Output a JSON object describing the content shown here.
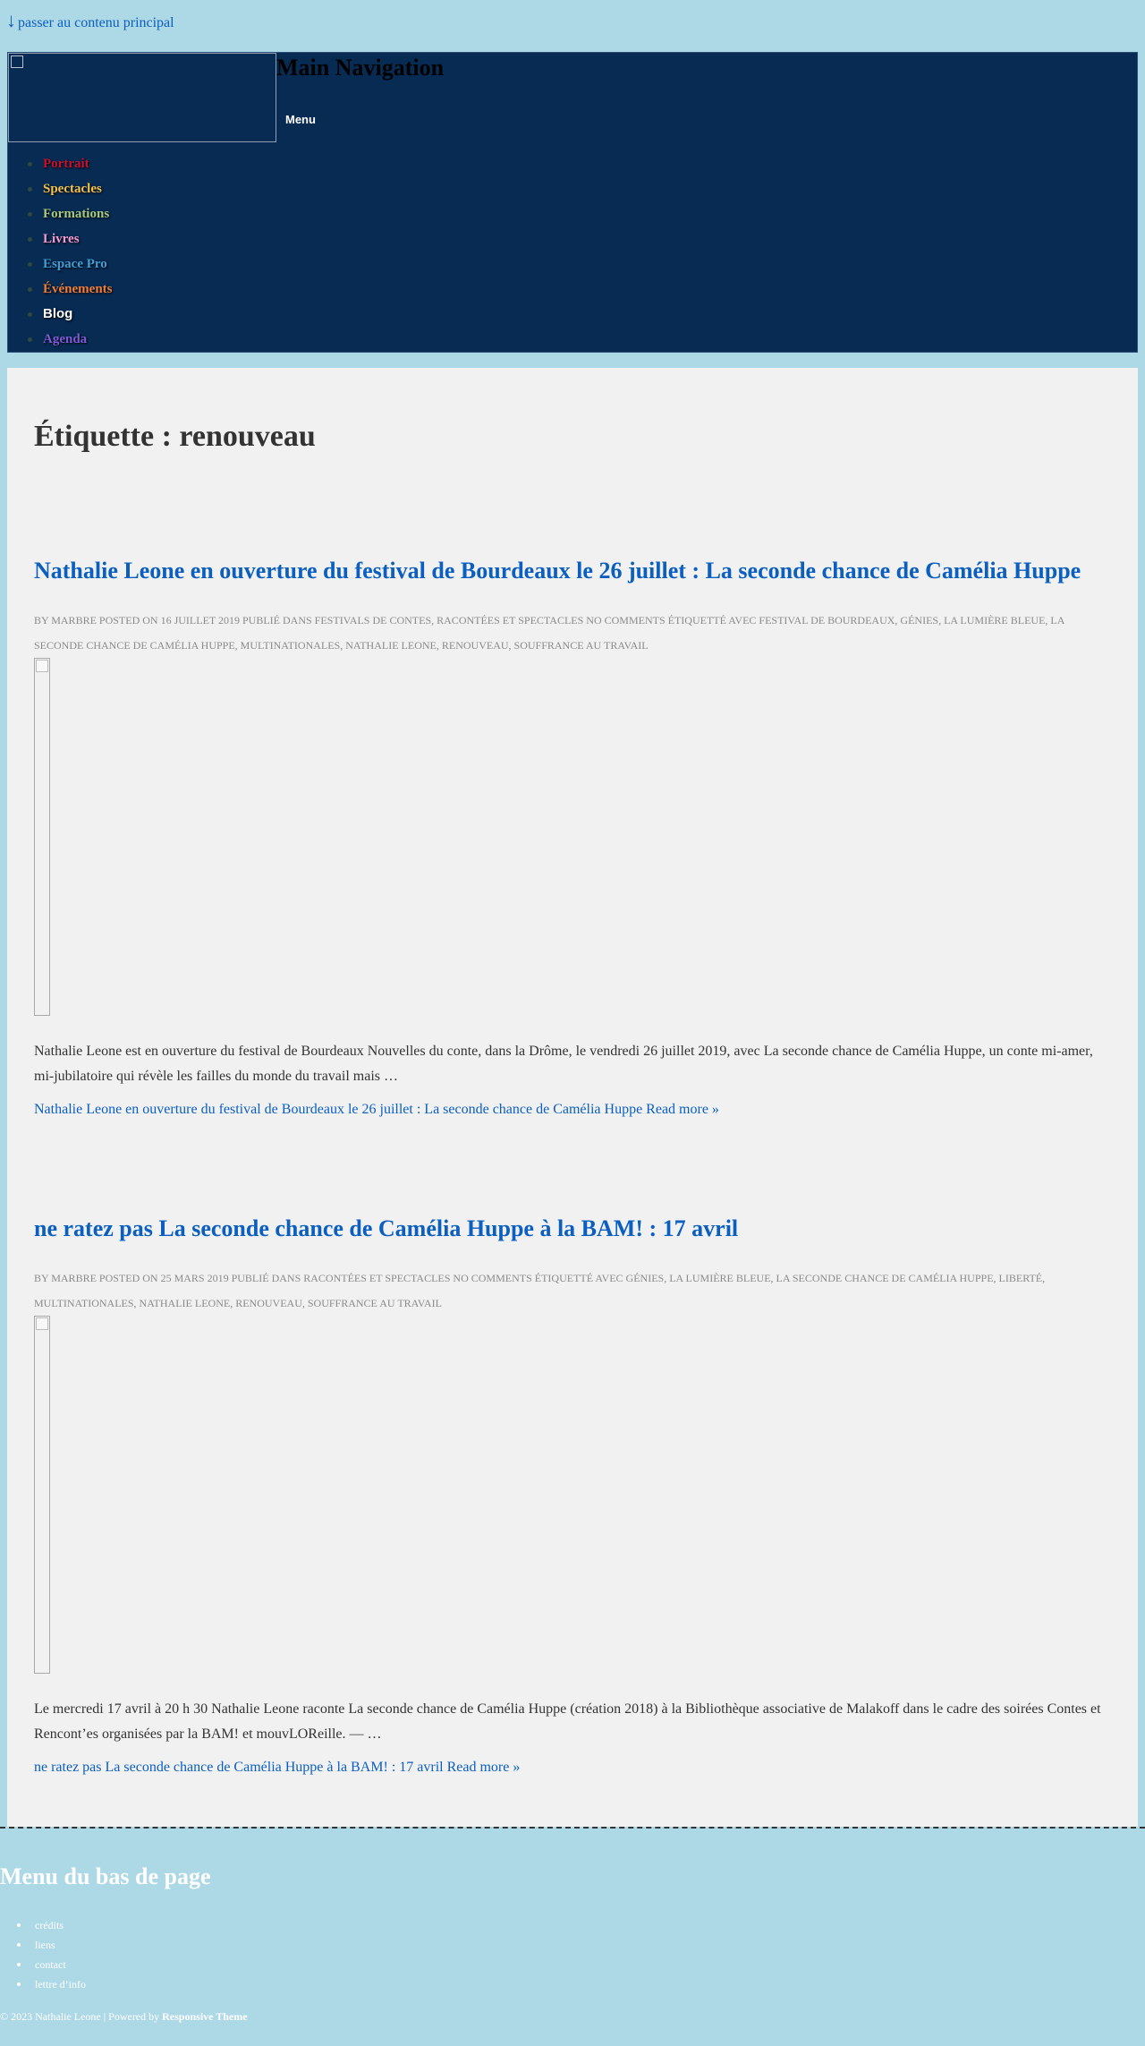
{
  "skip_link": {
    "arrow": "↓",
    "label": "passer au contenu principal"
  },
  "header": {
    "nav_title": "Main Navigation",
    "menu_label": "Menu",
    "nav_items": [
      {
        "label": "Portrait",
        "color": "#c8102e"
      },
      {
        "label": "Spectacles",
        "color": "#f2c14e"
      },
      {
        "label": "Formations",
        "color": "#a8c97f"
      },
      {
        "label": "Livres",
        "color": "#f59bd3"
      },
      {
        "label": "Espace Pro",
        "color": "#3f9fd6"
      },
      {
        "label": "Événements",
        "color": "#f07e3a"
      },
      {
        "label": "Blog",
        "color": "#ffffff"
      },
      {
        "label": "Agenda",
        "color": "#7e5bd6"
      }
    ]
  },
  "main": {
    "page_title": "Étiquette : renouveau",
    "posts": [
      {
        "title": "Nathalie Leone en ouverture du festival de Bourdeaux le 26 juillet : La seconde chance de Camélia Huppe",
        "meta": "By marbre Posted on 16 juillet 2019 Publié dans Festivals de contes, Racontées et spectacles No Comments Étiquetté avec festival de Bourdeaux, génies, la lumière bleue, La seconde chance de Camélia Huppe, multinationales, Nathalie Leone, renouveau, souffrance au travail",
        "excerpt": "Nathalie Leone est en ouverture du festival de Bourdeaux Nouvelles du conte, dans la Drôme, le vendredi 26 juillet 2019, avec La seconde chance de Camélia Huppe, un conte mi-amer, mi-jubilatoire qui révèle les failles du monde du travail mais …",
        "read_more": "Nathalie Leone en ouverture du festival de Bourdeaux le 26 juillet : La seconde chance de Camélia Huppe Read more »"
      },
      {
        "title": "ne ratez pas La seconde chance de Camélia Huppe à la BAM! : 17 avril",
        "meta": "By marbre Posted on 25 mars 2019 Publié dans Racontées et spectacles No Comments Étiquetté avec génies, la lumière bleue, La seconde chance de Camélia Huppe, liberté, multinationales, Nathalie Leone, renouveau, souffrance au travail",
        "excerpt": "Le mercredi 17 avril à 20 h 30 Nathalie Leone raconte La seconde chance de Camélia Huppe (création 2018) à la Bibliothèque associative de Malakoff dans le cadre des soirées Contes et Rencont’es organisées par la BAM! et mouvLOReille. — …",
        "read_more": "ne ratez pas La seconde chance de Camélia Huppe à la BAM! : 17 avril Read more »"
      }
    ]
  },
  "footer": {
    "title": "Menu du bas de page",
    "items": [
      "crédits",
      "liens",
      "contact",
      "lettre d’info"
    ],
    "copyright_prefix": "© 2023 Nathalie Leone | Powered by",
    "theme_link": "Responsive Theme"
  },
  "colors": {
    "link": "#0b5fc1",
    "header_bg": "#072b53",
    "page_bg": "#add8e6",
    "content_bg": "#f1f1f1"
  }
}
